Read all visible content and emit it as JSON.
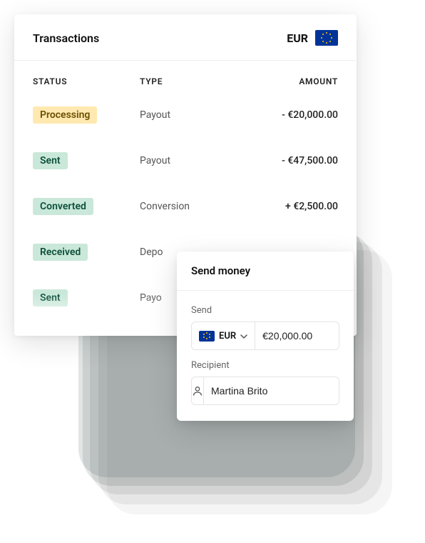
{
  "transactions": {
    "title": "Transactions",
    "currency": "EUR",
    "columns": {
      "status": "STATUS",
      "type": "TYPE",
      "amount": "AMOUNT"
    },
    "rows": [
      {
        "status": "Processing",
        "status_kind": "processing",
        "type": "Payout",
        "amount": "- €20,000.00"
      },
      {
        "status": "Sent",
        "status_kind": "sent",
        "type": "Payout",
        "amount": "- €47,500.00"
      },
      {
        "status": "Converted",
        "status_kind": "converted",
        "type": "Conversion",
        "amount": "+ €2,500.00"
      },
      {
        "status": "Received",
        "status_kind": "received",
        "type": "Depo",
        "amount": ""
      },
      {
        "status": "Sent",
        "status_kind": "sent",
        "type": "Payo",
        "amount": ""
      }
    ]
  },
  "send_money": {
    "title": "Send money",
    "send_label": "Send",
    "currency": "EUR",
    "amount": "€20,000.00",
    "recipient_label": "Recipient",
    "recipient_name": "Martina Brito"
  }
}
